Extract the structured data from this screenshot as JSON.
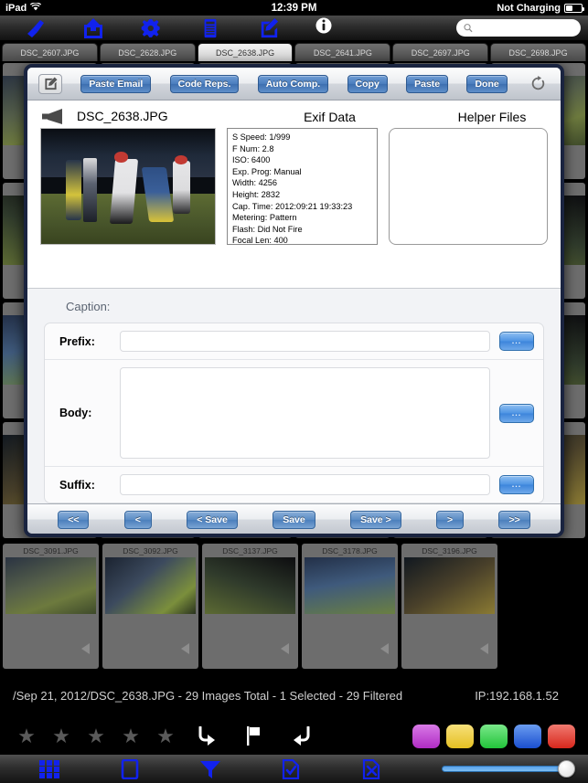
{
  "status_bar": {
    "device": "iPad",
    "wifi_icon": "wifi-icon",
    "time": "12:39 PM",
    "battery_text": "Not Charging",
    "battery_icon": "battery-icon"
  },
  "app_toolbar": {
    "icons": [
      {
        "name": "brush-icon",
        "label": "Brush"
      },
      {
        "name": "share-icon",
        "label": "Share"
      },
      {
        "name": "gear-icon",
        "label": "Settings"
      },
      {
        "name": "server-icon",
        "label": "Server"
      },
      {
        "name": "compose-icon",
        "label": "Compose"
      },
      {
        "name": "info-icon",
        "label": "Info"
      }
    ],
    "search": {
      "value": "",
      "placeholder": ""
    }
  },
  "tabs": [
    {
      "label": "DSC_2607.JPG",
      "selected": false
    },
    {
      "label": "DSC_2628.JPG",
      "selected": false
    },
    {
      "label": "DSC_2638.JPG",
      "selected": true
    },
    {
      "label": "DSC_2641.JPG",
      "selected": false
    },
    {
      "label": "DSC_2697.JPG",
      "selected": false
    },
    {
      "label": "DSC_2698.JPG",
      "selected": false
    }
  ],
  "modal": {
    "toolbar": {
      "compose_icon": "compose-icon",
      "paste_email": "Paste Email",
      "code_reps": "Code Reps.",
      "auto_comp": "Auto Comp.",
      "copy": "Copy",
      "paste": "Paste",
      "done": "Done",
      "refresh_icon": "refresh-icon"
    },
    "preview": {
      "speaker_icon": "speaker-icon",
      "filename": "DSC_2638.JPG"
    },
    "exif": {
      "title": "Exif Data",
      "lines": [
        "S Speed: 1/999",
        "F Num: 2.8",
        "ISO: 6400",
        "Exp. Prog: Manual",
        "Width: 4256",
        "Height: 2832",
        "Cap. Time: 2012:09:21 19:33:23",
        "Metering: Pattern",
        "Flash: Did Not Fire",
        "Focal Len: 400"
      ]
    },
    "helper_files": {
      "title": "Helper Files",
      "items": []
    },
    "caption": {
      "section_label": "Caption:",
      "prefix": {
        "label": "Prefix:",
        "value": "",
        "placeholder": "",
        "more_label": "..."
      },
      "body": {
        "label": "Body:",
        "value": "",
        "placeholder": "",
        "more_label": "..."
      },
      "suffix": {
        "label": "Suffix:",
        "value": "",
        "placeholder": "",
        "more_label": "..."
      }
    },
    "nav": {
      "first": "<<",
      "prev": "<",
      "save_prev": "< Save",
      "save": "Save",
      "save_next": "Save >",
      "next": ">",
      "last": ">>"
    }
  },
  "thumbnails": [
    {
      "name": "DSC_3091.JPG",
      "speaker_icon": "speaker-icon"
    },
    {
      "name": "DSC_3092.JPG",
      "speaker_icon": "speaker-icon"
    },
    {
      "name": "DSC_3137.JPG",
      "speaker_icon": "speaker-icon"
    },
    {
      "name": "DSC_3178.JPG",
      "speaker_icon": "speaker-icon"
    },
    {
      "name": "DSC_3196.JPG",
      "speaker_icon": "speaker-icon"
    }
  ],
  "info_bar": {
    "path_status": "/Sep 21, 2012/DSC_2638.JPG - 29 Images Total - 1 Selected - 29 Filtered",
    "ip": "IP:192.168.1.52"
  },
  "rating_bar": {
    "stars": [
      {
        "name": "star-1",
        "filled": false
      },
      {
        "name": "star-2",
        "filled": false
      },
      {
        "name": "star-3",
        "filled": false
      },
      {
        "name": "star-4",
        "filled": false
      },
      {
        "name": "star-5",
        "filled": false
      }
    ],
    "star_glyph": "★",
    "actions": [
      {
        "name": "redo-icon"
      },
      {
        "name": "flag-icon"
      },
      {
        "name": "undo-icon"
      }
    ],
    "color_tags": [
      {
        "name": "tag-purple",
        "color": "#c44ad0"
      },
      {
        "name": "tag-yellow",
        "color": "#efcf3c"
      },
      {
        "name": "tag-green",
        "color": "#3ece4a"
      },
      {
        "name": "tag-blue",
        "color": "#2a62e0"
      },
      {
        "name": "tag-red",
        "color": "#e23a2e"
      }
    ]
  },
  "bottom_toolbar": {
    "icons": [
      {
        "name": "grid-view-icon"
      },
      {
        "name": "single-view-icon"
      },
      {
        "name": "filter-icon"
      },
      {
        "name": "select-document-icon"
      },
      {
        "name": "deselect-document-icon"
      }
    ],
    "zoom_slider": {
      "name": "zoom-slider",
      "value": 100
    }
  },
  "colors": {
    "accent_blue": "#1122ee",
    "button_blue": "#4a7dbd",
    "modal_border": "#1a2440",
    "modal_bg": "#f2f3f6"
  }
}
